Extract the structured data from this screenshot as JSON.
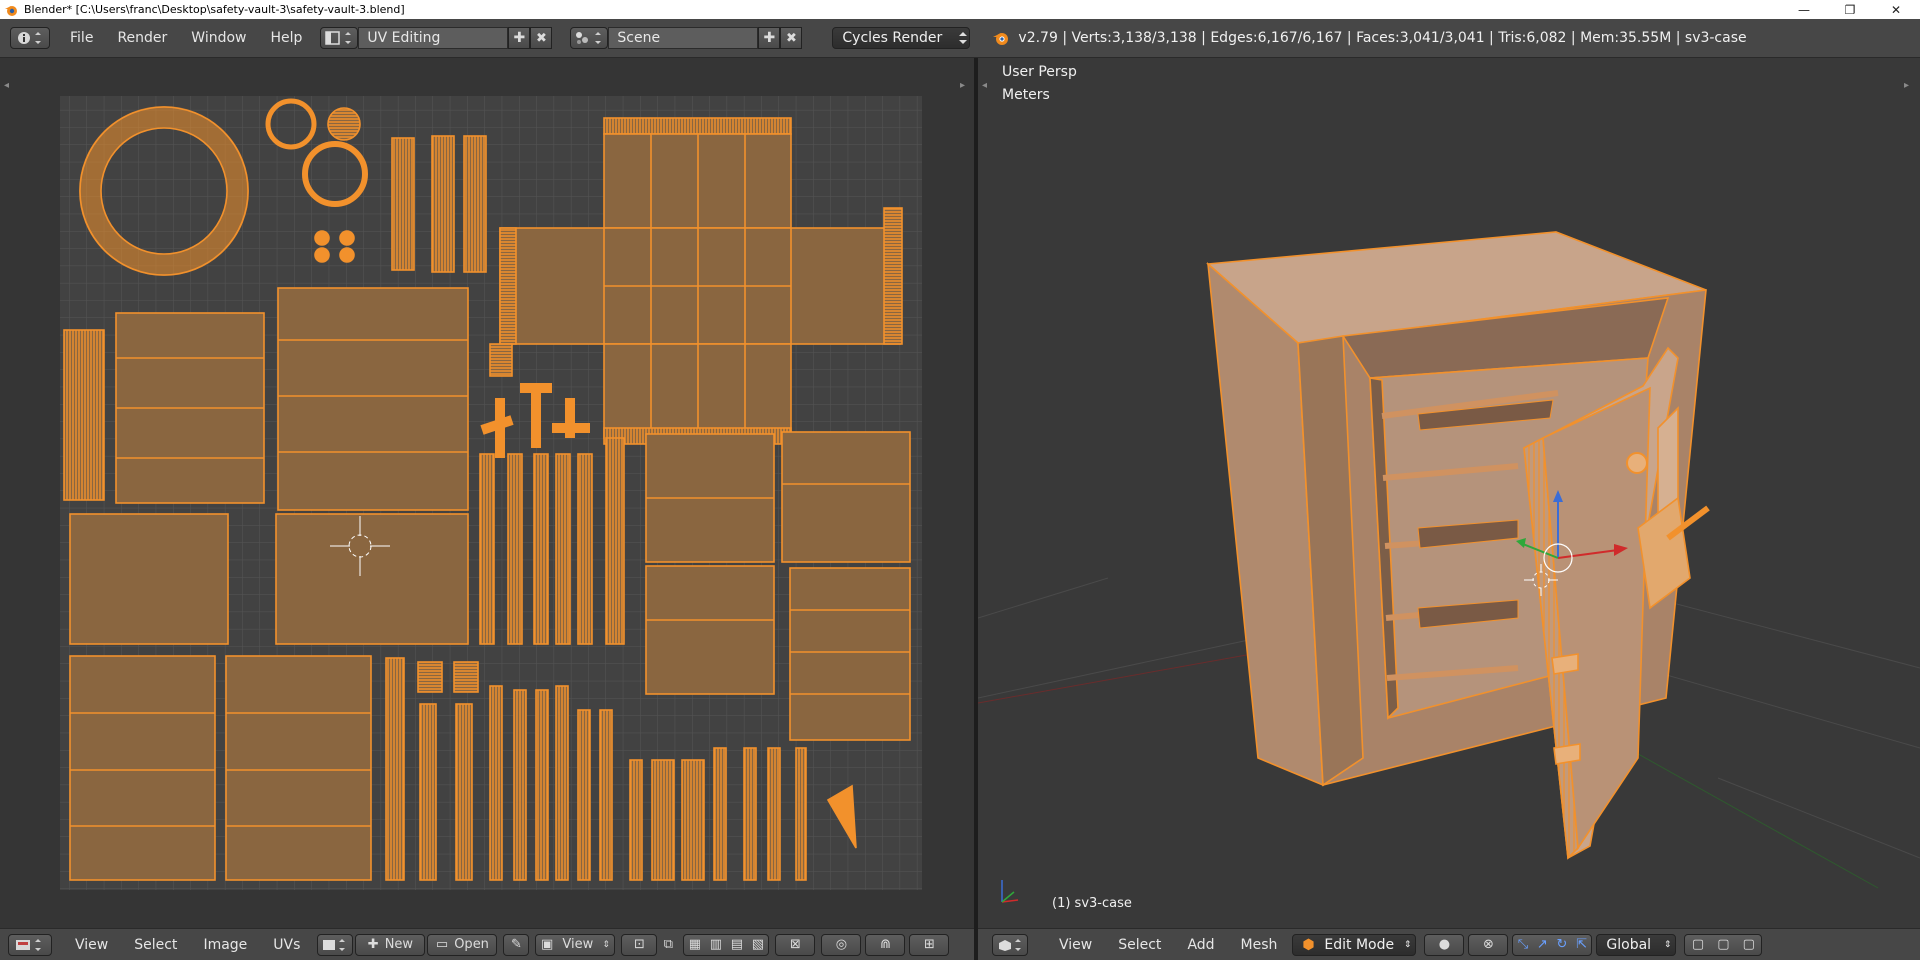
{
  "window": {
    "title": "Blender* [C:\\Users\\franc\\Desktop\\safety-vault-3\\safety-vault-3.blend]",
    "controls": [
      "—",
      "❐",
      "✕"
    ]
  },
  "topbar": {
    "menus": [
      "File",
      "Render",
      "Window",
      "Help"
    ],
    "screen_layout": "UV Editing",
    "scene": "Scene",
    "render_engine": "Cycles Render",
    "stats": "v2.79 | Verts:3,138/3,138 | Edges:6,167/6,167 | Faces:3,041/3,041 | Tris:6,082 | Mem:35.55M | sv3-case"
  },
  "uv_editor": {
    "menus": [
      "View",
      "Select",
      "Image",
      "UVs"
    ],
    "new_label": "New",
    "open_label": "Open",
    "view_label": "View"
  },
  "viewport": {
    "view_name": "User Persp",
    "units": "Meters",
    "object_label": "(1) sv3-case",
    "menus": [
      "View",
      "Select",
      "Add",
      "Mesh"
    ],
    "mode": "Edit Mode",
    "orientation": "Global"
  },
  "colors": {
    "accent": "#f2912c",
    "face_fill": "#8a6640",
    "grid_bg": "#424242",
    "selected_face": "#cfa47e"
  }
}
